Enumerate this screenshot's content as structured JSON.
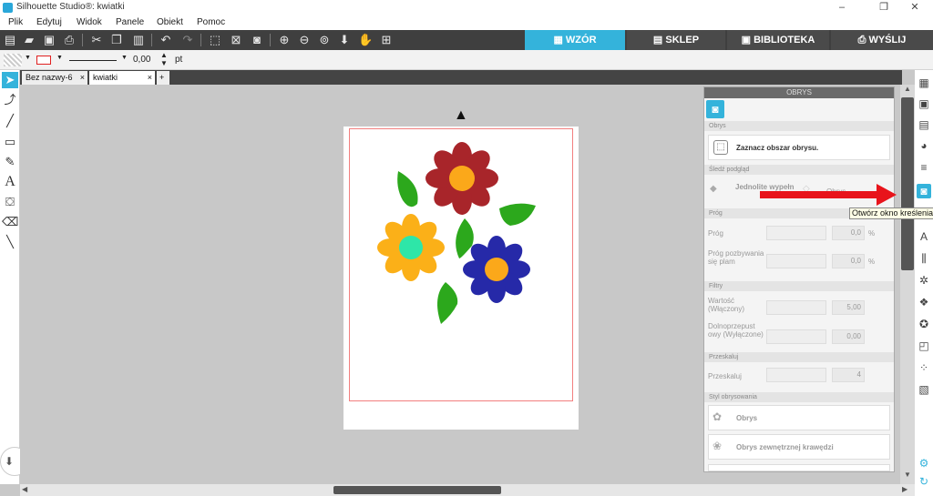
{
  "window": {
    "title": "Silhouette Studio®: kwiatki",
    "minimize": "–",
    "maximize": "❐",
    "close": "✕"
  },
  "menu": {
    "items": [
      "Plik",
      "Edytuj",
      "Widok",
      "Panele",
      "Obiekt",
      "Pomoc"
    ]
  },
  "nav_tabs": [
    {
      "label": "WZÓR",
      "icon": "grid-icon",
      "active": true
    },
    {
      "label": "SKLEP",
      "icon": "store-icon",
      "active": false
    },
    {
      "label": "BIBLIOTEKA",
      "icon": "library-icon",
      "active": false
    },
    {
      "label": "WYŚLIJ",
      "icon": "send-icon",
      "active": false
    }
  ],
  "properties": {
    "line_width": "0,00",
    "unit": "pt"
  },
  "doc_tabs": [
    {
      "label": "Bez nazwy-6",
      "close": "×"
    },
    {
      "label": "kwiatki",
      "close": "×"
    },
    {
      "label": "+"
    }
  ],
  "trace_panel": {
    "title": "OBRYS",
    "section_trace": "Obrys",
    "select_area_label": "Zaznacz obszar obrysu.",
    "section_preview": "Śledź podgląd",
    "preview_solid": "Jednolite wypełn",
    "preview_outline": "Obrys",
    "section_threshold": "Próg",
    "threshold_label": "Próg",
    "threshold_value": "0,0",
    "threshold_unit": "%",
    "removal_label": "Próg pozbywania się plam",
    "removal_value": "0,0",
    "removal_unit": "%",
    "section_filters": "Filtry",
    "value_label": "Wartość (Włączony)",
    "value_value": "5,00",
    "lowpass_label": "Dolnoprzepust owy (Wyłączone)",
    "lowpass_value": "0,00",
    "section_scale": "Przeskaluj",
    "scale_label": "Przeskaluj",
    "scale_value": "4",
    "section_style": "Styl obrysowania",
    "style_trace": "Obrys",
    "style_outer": "Obrys zewnętrznej krawędzi"
  },
  "tooltip": "Otwórz okno kreślenia",
  "colors": {
    "accent": "#34b3db",
    "arrow": "#e8141b",
    "red_petal": "#a8252a",
    "orange_petal": "#fbb018",
    "blue_petal": "#2629a8",
    "center": "#fba81a",
    "cyan_center": "#2ee6a8",
    "leaf": "#2ca81c"
  }
}
